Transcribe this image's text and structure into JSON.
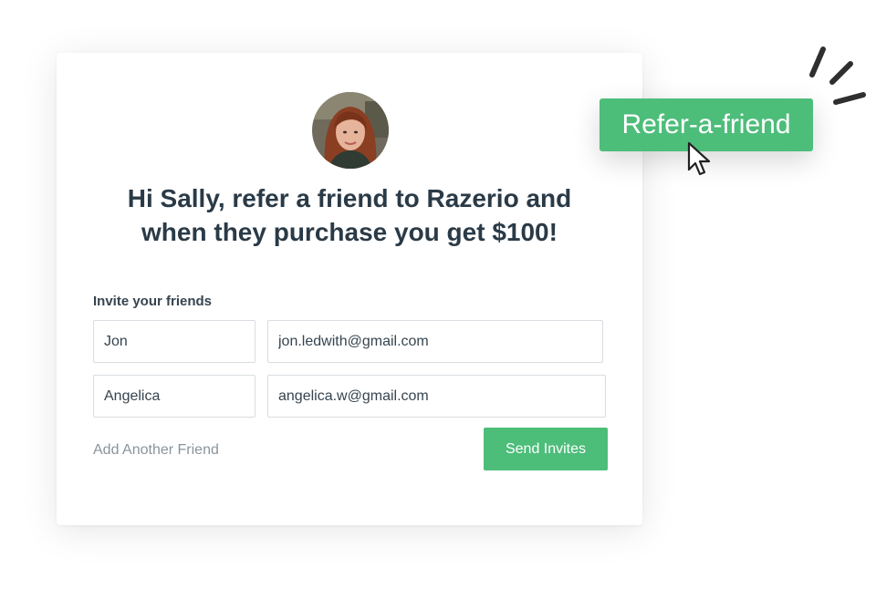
{
  "headline": {
    "line1": "Hi Sally, refer a friend to Razerio and",
    "line2": "when they purchase you get $100!"
  },
  "invite": {
    "label": "Invite your friends",
    "rows": [
      {
        "name": "Jon",
        "email": "jon.ledwith@gmail.com"
      },
      {
        "name": "Angelica",
        "email": "angelica.w@gmail.com"
      }
    ],
    "add_link": "Add Another Friend",
    "send_label": "Send Invites"
  },
  "refer_button": {
    "label": "Refer-a-friend"
  },
  "colors": {
    "accent": "#4dbd7a",
    "heading": "#2a3a47",
    "muted": "#8a949c"
  },
  "icons": [
    "avatar-photo",
    "pointer-cursor-icon",
    "burst-lines-icon"
  ]
}
